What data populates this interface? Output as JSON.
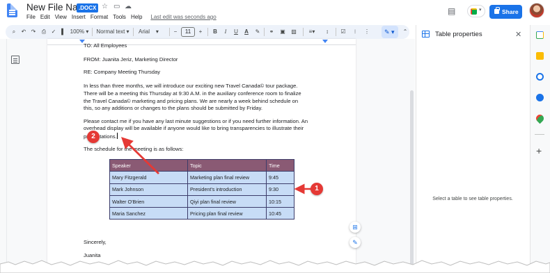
{
  "header": {
    "title": "New File Name",
    "badge": ".DOCX",
    "last_edit": "Last edit was seconds ago",
    "share_label": "Share"
  },
  "menu": [
    "File",
    "Edit",
    "View",
    "Insert",
    "Format",
    "Tools",
    "Help"
  ],
  "toolbar": {
    "zoom": "100%",
    "style": "Normal text",
    "font": "Arial",
    "font_size": "11"
  },
  "document": {
    "to_line": "TO: All Employees",
    "from_line": "FROM: Juanita Jeriz, Marketing Director",
    "re_line": "RE: Company Meeting Thursday",
    "para1": [
      "In less than three months, we will introduce our exciting new Travel Canada© tour package.",
      "There will be a meeting this Thursday at 9:30 A.M. in the auxiliary conference room to finalize",
      "the Travel Canada© marketing and pricing plans. We are nearly a week behind schedule on",
      "this, so any additions or changes to the plans should be submitted by Friday."
    ],
    "para2": [
      "Please contact me if you have any last minute suggestions or if you need further information. An",
      "overhead display will be available if anyone would like to bring transparencies to illustrate their",
      "presentations."
    ],
    "schedule_line": "The schedule for the meeting is as follows:",
    "table": {
      "headers": [
        "Speaker",
        "Topic",
        "Time"
      ],
      "rows": [
        [
          "Mary Fitzgerald",
          "Marketing plan final review",
          "9:45"
        ],
        [
          "Mark Johnson",
          "President's introduction",
          "9:30"
        ],
        [
          "Walter O'Brien",
          "Qiyi plan final review",
          "10:15"
        ],
        [
          "Maria Sanchez",
          "Pricing plan final review",
          "10:45"
        ]
      ]
    },
    "closing": "Sincerely,",
    "signature": "Juanita"
  },
  "callouts": [
    "1",
    "2"
  ],
  "side_panel": {
    "title": "Table properties",
    "message": "Select a table to see table properties."
  },
  "colors": {
    "accent": "#1a73e8",
    "header_row": "#8a5a74",
    "body_row": "#c7dcf6",
    "callout": "#e53935"
  }
}
